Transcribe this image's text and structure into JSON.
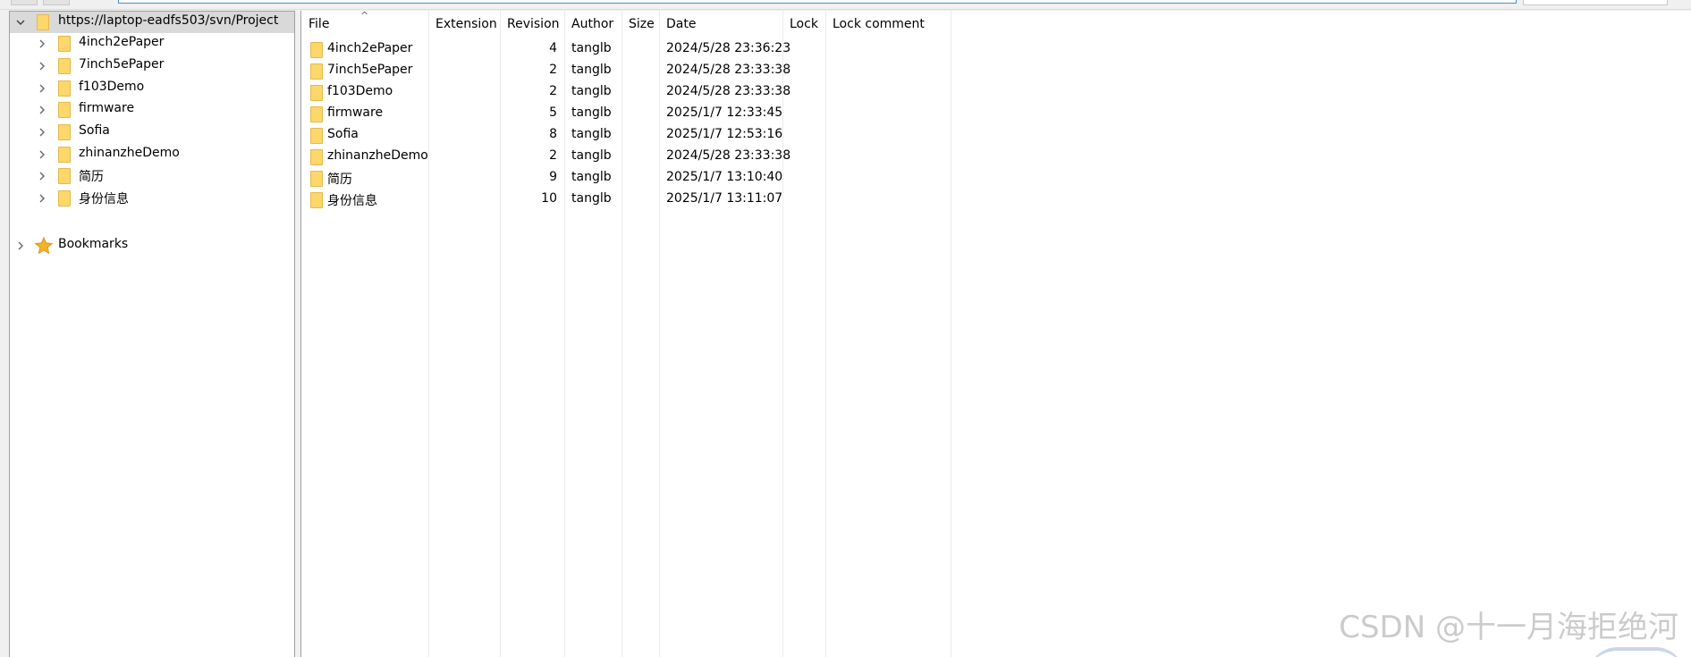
{
  "tree": {
    "root": {
      "label": "https://laptop-eadfs503/svn/Project",
      "expanded": true,
      "selected": true
    },
    "children": [
      {
        "label": "4inch2ePaper"
      },
      {
        "label": "7inch5ePaper"
      },
      {
        "label": "f103Demo"
      },
      {
        "label": "firmware"
      },
      {
        "label": "Sofia"
      },
      {
        "label": "zhinanzheDemo"
      },
      {
        "label": "简历"
      },
      {
        "label": "身份信息"
      }
    ],
    "bookmarks": {
      "label": "Bookmarks"
    }
  },
  "list": {
    "columns": {
      "file": "File",
      "extension": "Extension",
      "revision": "Revision",
      "author": "Author",
      "size": "Size",
      "date": "Date",
      "lock": "Lock",
      "lock_comment": "Lock comment"
    },
    "rows": [
      {
        "file": "4inch2ePaper",
        "extension": "",
        "revision": "4",
        "author": "tanglb",
        "size": "",
        "date": "2024/5/28 23:36:23",
        "lock": "",
        "lock_comment": ""
      },
      {
        "file": "7inch5ePaper",
        "extension": "",
        "revision": "2",
        "author": "tanglb",
        "size": "",
        "date": "2024/5/28 23:33:38",
        "lock": "",
        "lock_comment": ""
      },
      {
        "file": "f103Demo",
        "extension": "",
        "revision": "2",
        "author": "tanglb",
        "size": "",
        "date": "2024/5/28 23:33:38",
        "lock": "",
        "lock_comment": ""
      },
      {
        "file": "firmware",
        "extension": "",
        "revision": "5",
        "author": "tanglb",
        "size": "",
        "date": "2025/1/7 12:33:45",
        "lock": "",
        "lock_comment": ""
      },
      {
        "file": "Sofia",
        "extension": "",
        "revision": "8",
        "author": "tanglb",
        "size": "",
        "date": "2025/1/7 12:53:16",
        "lock": "",
        "lock_comment": ""
      },
      {
        "file": "zhinanzheDemo",
        "extension": "",
        "revision": "2",
        "author": "tanglb",
        "size": "",
        "date": "2024/5/28 23:33:38",
        "lock": "",
        "lock_comment": ""
      },
      {
        "file": "简历",
        "extension": "",
        "revision": "9",
        "author": "tanglb",
        "size": "",
        "date": "2025/1/7 13:10:40",
        "lock": "",
        "lock_comment": ""
      },
      {
        "file": "身份信息",
        "extension": "",
        "revision": "10",
        "author": "tanglb",
        "size": "",
        "date": "2025/1/7 13:11:07",
        "lock": "",
        "lock_comment": ""
      }
    ]
  },
  "watermark": "CSDN @十一月海拒绝河",
  "colors": {
    "folder": "#fcd76a",
    "selection": "#d9d9d9",
    "address_border": "#4a90c8"
  }
}
